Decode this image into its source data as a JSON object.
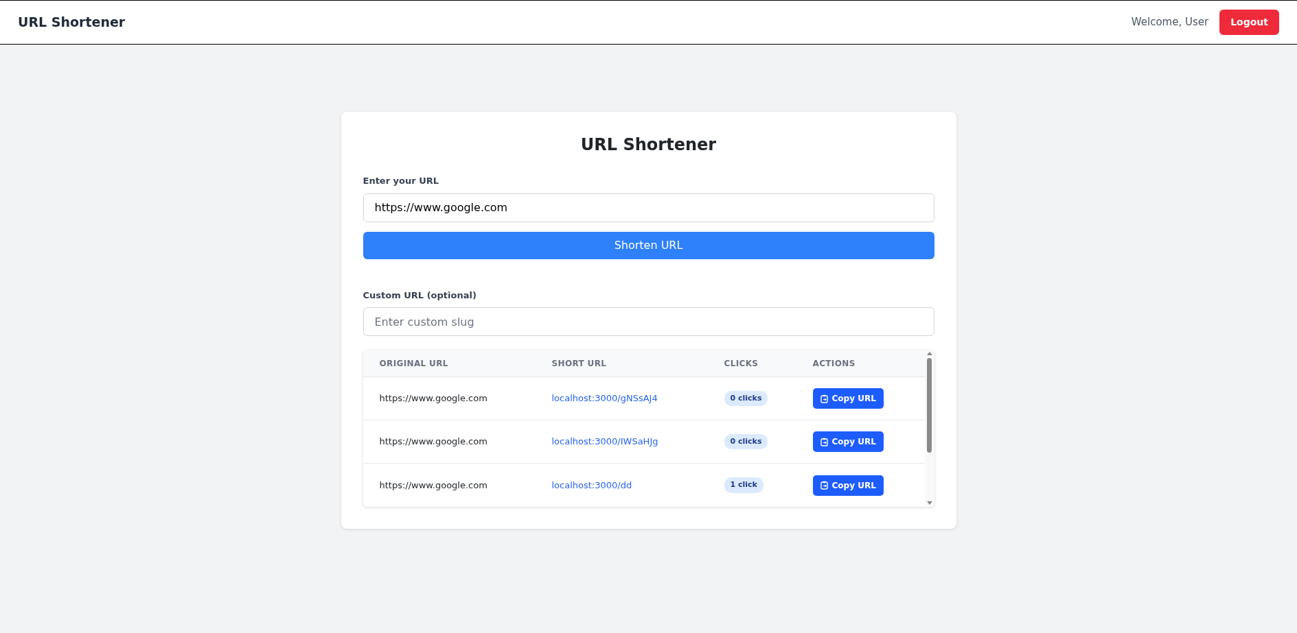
{
  "navbar": {
    "brand": "URL Shortener",
    "welcome": "Welcome, User",
    "logout": "Logout"
  },
  "card": {
    "title": "URL Shortener",
    "url_field": {
      "label": "Enter your URL",
      "value": "https://www.google.com"
    },
    "shorten_button": "Shorten URL",
    "custom_field": {
      "label": "Custom URL (optional)",
      "placeholder": "Enter custom slug"
    },
    "table": {
      "columns": [
        "ORIGINAL URL",
        "SHORT URL",
        "CLICKS",
        "ACTIONS"
      ],
      "rows": [
        {
          "original": "https://www.google.com",
          "short": "localhost:3000/gNSsAJ4",
          "clicks": "0 clicks",
          "action": "Copy URL"
        },
        {
          "original": "https://www.google.com",
          "short": "localhost:3000/IWSaHJg",
          "clicks": "0 clicks",
          "action": "Copy URL"
        },
        {
          "original": "https://www.google.com",
          "short": "localhost:3000/dd",
          "clicks": "1 click",
          "action": "Copy URL"
        }
      ]
    }
  }
}
